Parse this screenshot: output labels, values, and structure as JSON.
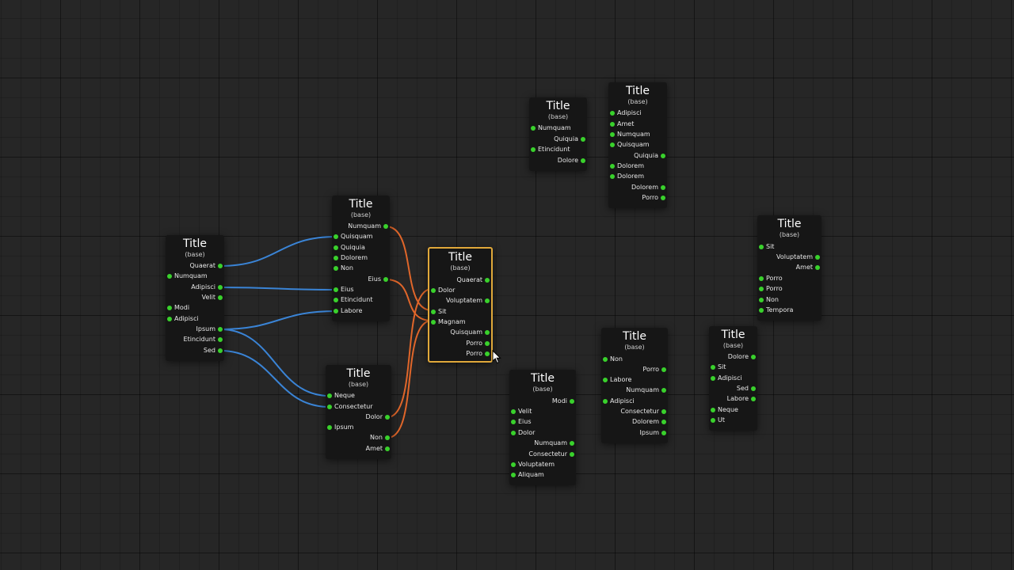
{
  "colors": {
    "background": "#262626",
    "node": "#161616",
    "port": "#39d12c",
    "wire_blue": "#3a84d6",
    "wire_orange": "#e0662a",
    "selected_border": "#e0a83a"
  },
  "nodes": [
    {
      "id": "n1",
      "title": "Title",
      "subtitle": "(base)",
      "selected": false,
      "ports": [
        {
          "side": "out",
          "label": "Quaerat"
        },
        {
          "side": "in",
          "label": "Numquam"
        },
        {
          "side": "out",
          "label": "Adipisci"
        },
        {
          "side": "out",
          "label": "Velit"
        },
        {
          "side": "in",
          "label": "Modi"
        },
        {
          "side": "in",
          "label": "Adipisci"
        },
        {
          "side": "out",
          "label": "Ipsum"
        },
        {
          "side": "out",
          "label": "Etincidunt"
        },
        {
          "side": "out",
          "label": "Sed"
        }
      ]
    },
    {
      "id": "n2",
      "title": "Title",
      "subtitle": "(base)",
      "selected": false,
      "ports": [
        {
          "side": "out",
          "label": "Numquam"
        },
        {
          "side": "in",
          "label": "Quisquam"
        },
        {
          "side": "in",
          "label": "Quiquia"
        },
        {
          "side": "in",
          "label": "Dolorem"
        },
        {
          "side": "in",
          "label": "Non"
        },
        {
          "side": "out",
          "label": "Eius"
        },
        {
          "side": "in",
          "label": "Eius"
        },
        {
          "side": "in",
          "label": "Etincidunt"
        },
        {
          "side": "in",
          "label": "Labore"
        }
      ]
    },
    {
      "id": "n3",
      "title": "Title",
      "subtitle": "(base)",
      "selected": false,
      "ports": [
        {
          "side": "in",
          "label": "Neque"
        },
        {
          "side": "in",
          "label": "Consectetur"
        },
        {
          "side": "out",
          "label": "Dolor"
        },
        {
          "side": "in",
          "label": "Ipsum"
        },
        {
          "side": "out",
          "label": "Non"
        },
        {
          "side": "out",
          "label": "Amet"
        }
      ]
    },
    {
      "id": "n4",
      "title": "Title",
      "subtitle": "(base)",
      "selected": true,
      "ports": [
        {
          "side": "out",
          "label": "Quaerat"
        },
        {
          "side": "in",
          "label": "Dolor"
        },
        {
          "side": "out",
          "label": "Voluptatem"
        },
        {
          "side": "in",
          "label": "Sit"
        },
        {
          "side": "in",
          "label": "Magnam"
        },
        {
          "side": "out",
          "label": "Quisquam"
        },
        {
          "side": "out",
          "label": "Porro"
        },
        {
          "side": "out",
          "label": "Porro"
        }
      ]
    },
    {
      "id": "n5",
      "title": "Title",
      "subtitle": "(base)",
      "selected": false,
      "ports": [
        {
          "side": "in",
          "label": "Numquam"
        },
        {
          "side": "out",
          "label": "Quiquia"
        },
        {
          "side": "in",
          "label": "Etincidunt"
        },
        {
          "side": "out",
          "label": "Dolore"
        }
      ]
    },
    {
      "id": "n6",
      "title": "Title",
      "subtitle": "(base)",
      "selected": false,
      "ports": [
        {
          "side": "in",
          "label": "Adipisci"
        },
        {
          "side": "in",
          "label": "Amet"
        },
        {
          "side": "in",
          "label": "Numquam"
        },
        {
          "side": "in",
          "label": "Quisquam"
        },
        {
          "side": "out",
          "label": "Quiquia"
        },
        {
          "side": "in",
          "label": "Dolorem"
        },
        {
          "side": "in",
          "label": "Dolorem"
        },
        {
          "side": "out",
          "label": "Dolorem"
        },
        {
          "side": "out",
          "label": "Porro"
        }
      ]
    },
    {
      "id": "n7",
      "title": "Title",
      "subtitle": "(base)",
      "selected": false,
      "ports": [
        {
          "side": "in",
          "label": "Sit"
        },
        {
          "side": "out",
          "label": "Voluptatem"
        },
        {
          "side": "out",
          "label": "Amet"
        },
        {
          "side": "in",
          "label": "Porro"
        },
        {
          "side": "in",
          "label": "Porro"
        },
        {
          "side": "in",
          "label": "Non"
        },
        {
          "side": "in",
          "label": "Tempora"
        }
      ]
    },
    {
      "id": "n8",
      "title": "Title",
      "subtitle": "(base)",
      "selected": false,
      "ports": [
        {
          "side": "out",
          "label": "Modi"
        },
        {
          "side": "in",
          "label": "Velit"
        },
        {
          "side": "in",
          "label": "Eius"
        },
        {
          "side": "in",
          "label": "Dolor"
        },
        {
          "side": "out",
          "label": "Numquam"
        },
        {
          "side": "out",
          "label": "Consectetur"
        },
        {
          "side": "in",
          "label": "Voluptatem"
        },
        {
          "side": "in",
          "label": "Aliquam"
        }
      ]
    },
    {
      "id": "n9",
      "title": "Title",
      "subtitle": "(base)",
      "selected": false,
      "ports": [
        {
          "side": "in",
          "label": "Non"
        },
        {
          "side": "out",
          "label": "Porro"
        },
        {
          "side": "in",
          "label": "Labore"
        },
        {
          "side": "out",
          "label": "Numquam"
        },
        {
          "side": "in",
          "label": "Adipisci"
        },
        {
          "side": "out",
          "label": "Consectetur"
        },
        {
          "side": "out",
          "label": "Dolorem"
        },
        {
          "side": "out",
          "label": "Ipsum"
        }
      ]
    },
    {
      "id": "n10",
      "title": "Title",
      "subtitle": "(base)",
      "selected": false,
      "ports": [
        {
          "side": "out",
          "label": "Dolore"
        },
        {
          "side": "in",
          "label": "Sit"
        },
        {
          "side": "in",
          "label": "Adipisci"
        },
        {
          "side": "out",
          "label": "Sed"
        },
        {
          "side": "out",
          "label": "Labore"
        },
        {
          "side": "in",
          "label": "Neque"
        },
        {
          "side": "in",
          "label": "Ut"
        }
      ]
    }
  ],
  "connections": [
    {
      "from": "n1",
      "from_port": 0,
      "to": "n2",
      "to_port": 1,
      "color": "blue"
    },
    {
      "from": "n1",
      "from_port": 2,
      "to": "n2",
      "to_port": 6,
      "color": "blue"
    },
    {
      "from": "n1",
      "from_port": 6,
      "to": "n2",
      "to_port": 8,
      "color": "blue"
    },
    {
      "from": "n1",
      "from_port": 6,
      "to": "n3",
      "to_port": 0,
      "color": "blue"
    },
    {
      "from": "n1",
      "from_port": 8,
      "to": "n3",
      "to_port": 1,
      "color": "blue"
    },
    {
      "from": "n2",
      "from_port": 0,
      "to": "n4",
      "to_port": 3,
      "color": "orange"
    },
    {
      "from": "n2",
      "from_port": 5,
      "to": "n4",
      "to_port": 4,
      "color": "orange"
    },
    {
      "from": "n3",
      "from_port": 2,
      "to": "n4",
      "to_port": 1,
      "color": "orange"
    },
    {
      "from": "n3",
      "from_port": 4,
      "to": "n4",
      "to_port": 4,
      "color": "orange"
    }
  ]
}
